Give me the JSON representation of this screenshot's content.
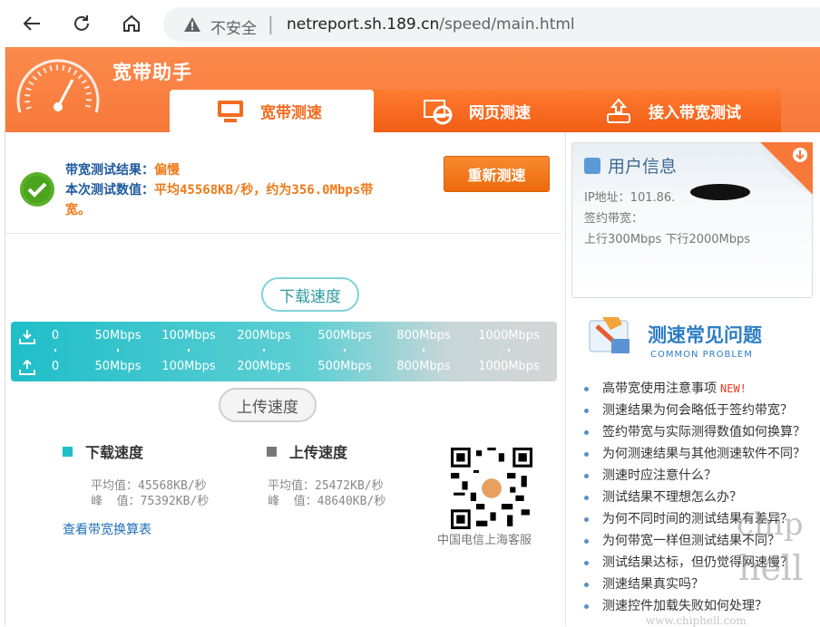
{
  "browser": {
    "insecure_label": "不安全",
    "url_host": "netreport.sh.189.cn",
    "url_path": "/speed/main.html"
  },
  "banner": {
    "title": "宽带助手",
    "tabs": [
      {
        "label": "宽带测速",
        "active": true
      },
      {
        "label": "网页测速",
        "active": false
      },
      {
        "label": "接入带宽测试",
        "active": false
      }
    ]
  },
  "result": {
    "result_label": "带宽测试结果：",
    "result_value": "偏慢",
    "numeric_label": "本次测试数值：",
    "numeric_value_line1": "平均45568KB/秒，约为356.0Mbps带",
    "numeric_value_line2": "宽。",
    "retest_button": "重新测速"
  },
  "speed_bar": {
    "download_bubble": "下载速度",
    "upload_bubble": "上传速度",
    "ticks": [
      "0",
      "50Mbps",
      "100Mbps",
      "200Mbps",
      "500Mbps",
      "800Mbps",
      "1000Mbps"
    ]
  },
  "stats": {
    "download_title": "下载速度",
    "download_avg": "平均值：45568KB/秒",
    "download_peak": "峰  值：75392KB/秒",
    "upload_title": "上传速度",
    "upload_avg": "平均值：25472KB/秒",
    "upload_peak": "峰  值：48640KB/秒",
    "conversion_link": "查看带宽换算表",
    "qr_caption": "中国电信上海客服"
  },
  "colors": {
    "download": "#1fbec9",
    "upload": "#777777",
    "accent_orange": "#f7793a"
  },
  "user_info": {
    "title": "用户信息",
    "ip": "IP地址：101.86.",
    "bandwidth_label": "签约带宽：",
    "bandwidth_value": "上行300Mbps  下行2000Mbps"
  },
  "faq": {
    "title": "测速常见问题",
    "subtitle": "COMMON PROBLEM",
    "new_badge": "NEW!",
    "items": [
      "高带宽使用注意事项",
      "测速结果为何会略低于签约带宽？",
      "签约带宽与实际测得数值如何换算？",
      "为何测速结果与其他测速软件不同？",
      "测速时应注意什么？",
      "测试结果不理想怎么办？",
      "为何不同时间的测试结果有差异？",
      "为何带宽一样但测试结果不同？",
      "测试结果达标，但仍觉得网速慢？",
      "测速结果真实吗？",
      "测速控件加载失败如何处理？"
    ]
  },
  "watermark": {
    "text1": "chip",
    "text2": "hell",
    "site": "www.chiphell.com"
  }
}
